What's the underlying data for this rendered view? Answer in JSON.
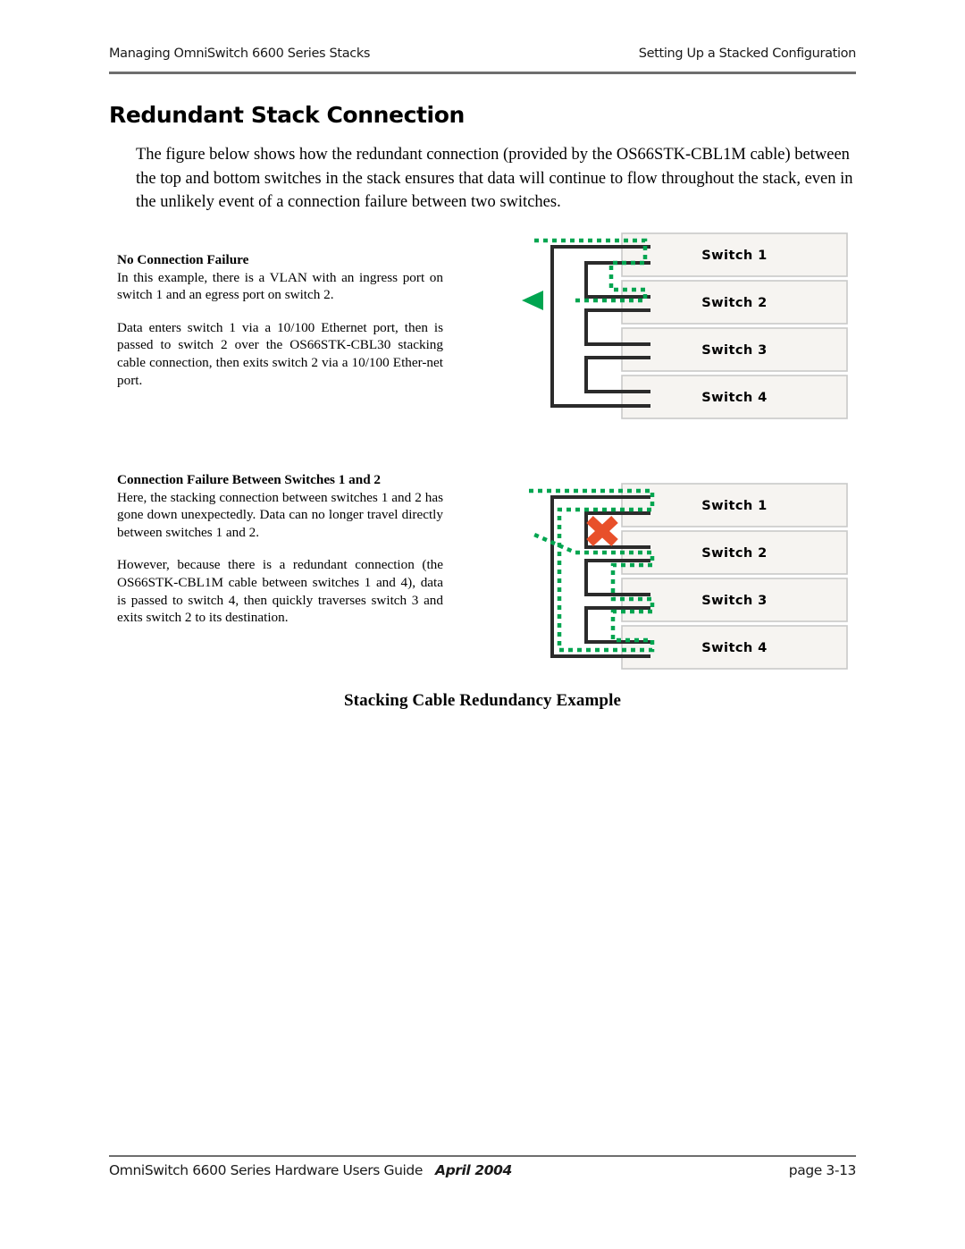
{
  "header": {
    "left": "Managing OmniSwitch 6600 Series Stacks",
    "right": "Setting Up a Stacked Configuration"
  },
  "title": "Redundant Stack Connection",
  "intro": "The figure below shows how the redundant connection (provided by the OS66STK-CBL1M cable) between the top and bottom switches in the stack ensures that data will continue to flow throughout the stack, even in the unlikely event of a connection failure between two switches.",
  "sections": [
    {
      "heading": "No Connection Failure",
      "paragraphs": [
        "In this example, there is a VLAN with an ingress port on switch 1 and an egress port on switch 2.",
        "Data enters switch 1 via a 10/100 Ethernet port, then is passed to switch 2 over the OS66STK-CBL30 stacking cable connection, then exits switch 2 via a 10/100 Ether-net port."
      ]
    },
    {
      "heading": "Connection Failure Between Switches 1 and 2",
      "paragraphs": [
        "Here, the stacking connection between switches 1 and 2 has gone down unexpectedly. Data can no longer travel directly between switches 1 and 2.",
        "However, because there is a redundant connection (the OS66STK-CBL1M cable between switches 1 and 4), data is passed to switch 4, then quickly traverses switch 3 and exits switch 2 to its destination."
      ]
    }
  ],
  "figure": {
    "caption": "Stacking Cable Redundancy Example",
    "switch_labels": [
      "Switch 1",
      "Switch 2",
      "Switch 3",
      "Switch 4"
    ],
    "colors": {
      "data_path": "#00A550",
      "cable": "#2b2b2b",
      "failure_mark": "#E8502A",
      "switch_fill": "#f6f4f1",
      "switch_border": "#c9c9c9"
    },
    "diagram_1_name": "No Connection Failure",
    "diagram_2_name": "Connection Failure Between Switches 1 and 2"
  },
  "footer": {
    "guide": "OmniSwitch 6600 Series Hardware Users Guide",
    "date": "April 2004",
    "page": "page 3-13"
  }
}
